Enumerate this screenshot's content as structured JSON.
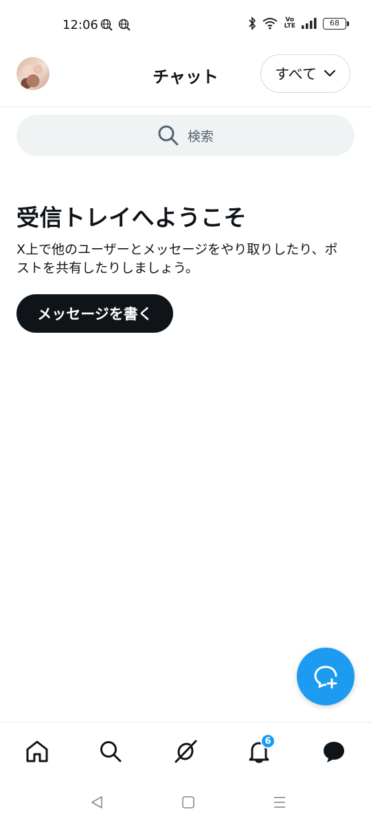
{
  "status_bar": {
    "time": "12:06",
    "battery": "68",
    "volte_top": "Vo",
    "volte_bottom": "LTE"
  },
  "header": {
    "title": "チャット",
    "filter_label": "すべて"
  },
  "search": {
    "placeholder": "検索"
  },
  "welcome": {
    "title": "受信トレイへようこそ",
    "description": "X上で他のユーザーとメッセージをやり取りしたり、ポストを共有したりしましょう。",
    "button_label": "メッセージを書く"
  },
  "bottom_nav": {
    "items": [
      {
        "icon": "home-icon"
      },
      {
        "icon": "search-icon"
      },
      {
        "icon": "grok-icon"
      },
      {
        "icon": "bell-icon",
        "badge": "6"
      },
      {
        "icon": "messages-icon"
      }
    ]
  },
  "colors": {
    "accent": "#1d9bf0",
    "text": "#0f1419",
    "muted": "#536471",
    "search_bg": "#eff3f4"
  }
}
